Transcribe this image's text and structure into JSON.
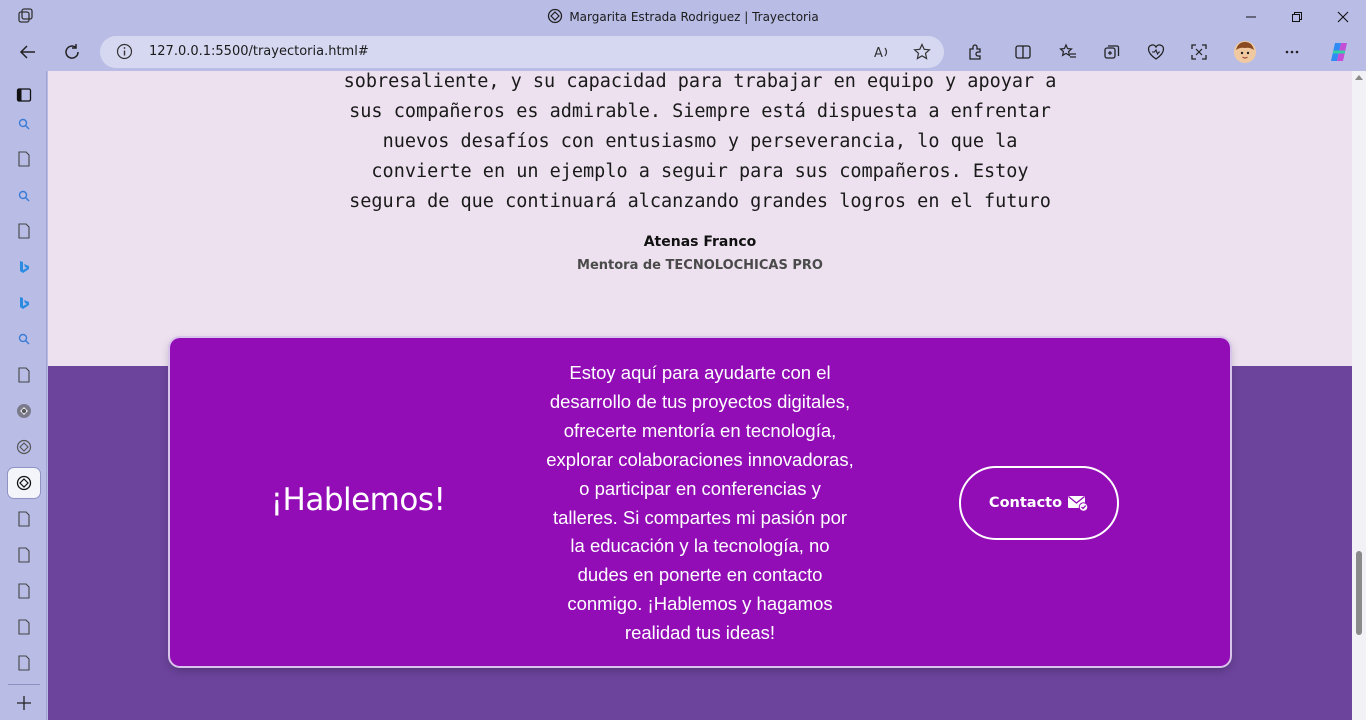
{
  "window": {
    "title": "Margarita Estrada Rodriguez | Trayectoria"
  },
  "addressbar": {
    "url": "127.0.0.1:5500/trayectoria.html#"
  },
  "testimonial": {
    "quote_lines": [
      "sobresaliente, y su capacidad para trabajar en equipo y apoyar a",
      "sus compañeros es admirable. Siempre está dispuesta a enfrentar",
      "nuevos desafíos con entusiasmo y perseverancia, lo que la",
      "convierte en un ejemplo a seguir para sus compañeros. Estoy",
      "segura de que continuará alcanzando grandes logros en el futuro"
    ],
    "author": "Atenas Franco",
    "role": "Mentora de TECNOLOCHICAS PRO"
  },
  "cta": {
    "heading": "¡Hablemos!",
    "text_lines": [
      "Estoy aquí para ayudarte con el",
      "desarrollo de tus proyectos digitales,",
      "ofrecerte mentoría en tecnología,",
      "explorar colaboraciones innovadoras,",
      "o participar en conferencias y",
      "talleres. Si compartes mi pasión por",
      "la educación y la tecnología, no",
      "dudes en ponerte en contacto",
      "conmigo. ¡Hablemos y hagamos",
      "realidad tus ideas!"
    ],
    "button_label": "Contacto",
    "button_icon": "mail-check-icon"
  },
  "colors": {
    "browser_chrome": "#b9bde6",
    "page_background": "#ede1f0",
    "footer_band": "#6c449c",
    "cta_card": "#930db7"
  }
}
